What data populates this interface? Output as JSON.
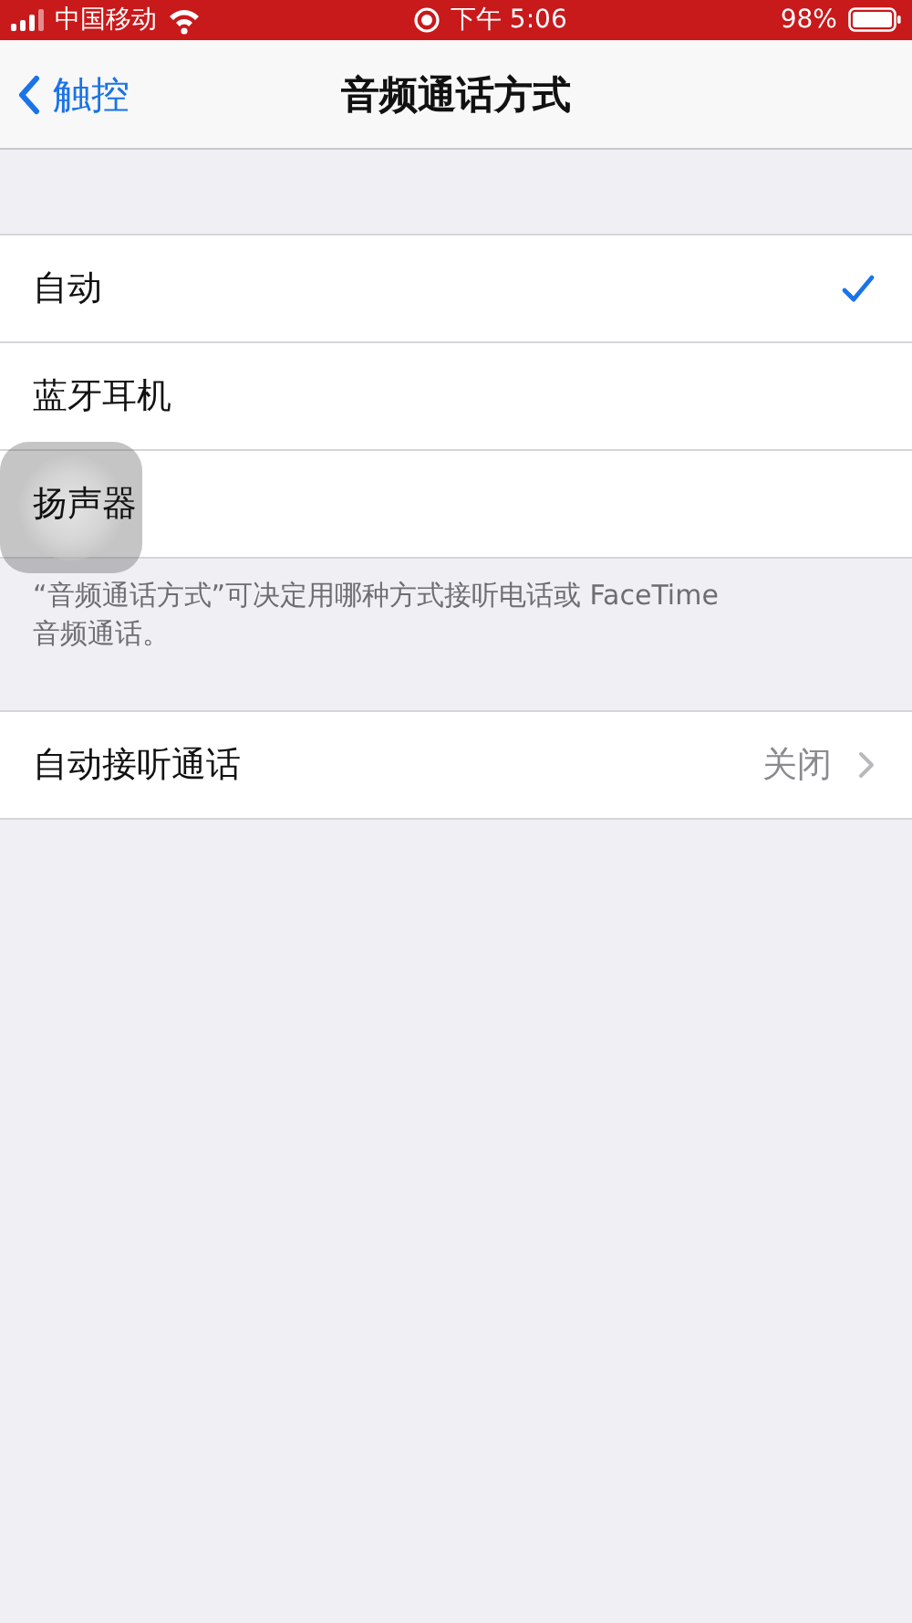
{
  "status_bar": {
    "carrier": "中国移动",
    "time": "下午 5:06",
    "battery": "98%"
  },
  "nav": {
    "back_label": "触控",
    "title": "音频通话方式"
  },
  "options": [
    {
      "label": "自动",
      "selected": true
    },
    {
      "label": "蓝牙耳机",
      "selected": false
    },
    {
      "label": "扬声器",
      "selected": false
    }
  ],
  "footer": "“音频通话方式”可决定用哪种方式接听电话或 FaceTime 音频通话。",
  "settings": [
    {
      "label": "自动接听通话",
      "value": "关闭"
    }
  ]
}
